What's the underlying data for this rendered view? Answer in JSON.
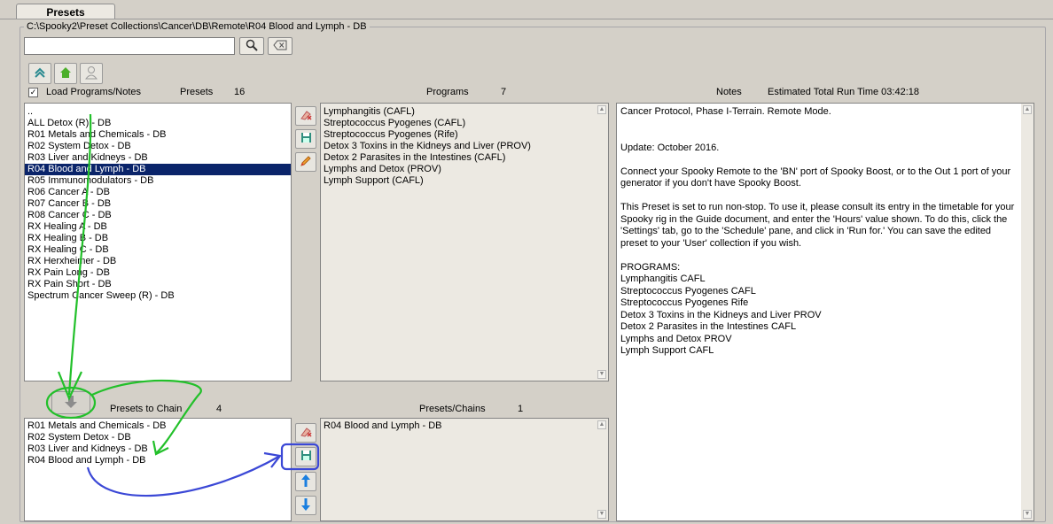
{
  "tab": {
    "label": "Presets"
  },
  "group": {
    "path": "C:\\Spooky2\\Preset Collections\\Cancer\\DB\\Remote\\R04 Blood and Lymph - DB"
  },
  "search": {
    "value": "",
    "placeholder": ""
  },
  "load_programs": {
    "label": "Load Programs/Notes",
    "checked": true
  },
  "presets": {
    "label": "Presets",
    "count": "16",
    "items": [
      "..",
      "ALL Detox (R) - DB",
      "R01 Metals and Chemicals - DB",
      "R02 System Detox - DB",
      "R03 Liver and Kidneys - DB",
      "R04 Blood and Lymph - DB",
      "R05 Immunomodulators - DB",
      "R06 Cancer A - DB",
      "R07 Cancer B - DB",
      "R08 Cancer C - DB",
      "RX Healing A - DB",
      "RX Healing B - DB",
      "RX Healing C - DB",
      "RX Herxheimer - DB",
      "RX Pain Long - DB",
      "RX Pain Short - DB",
      "Spectrum Cancer Sweep (R) - DB"
    ],
    "selected_index": 5
  },
  "programs": {
    "label": "Programs",
    "count": "7",
    "items": [
      "Lymphangitis (CAFL)",
      "Streptococcus Pyogenes (CAFL)",
      "Streptococcus Pyogenes (Rife)",
      "Detox 3 Toxins in the Kidneys and Liver (PROV)",
      "Detox 2 Parasites in the Intestines (CAFL)",
      "Lymphs and Detox (PROV)",
      "Lymph Support (CAFL)"
    ]
  },
  "notes": {
    "label": "Notes",
    "runtime": "Estimated Total Run Time 03:42:18",
    "lines": [
      "Cancer Protocol, Phase I-Terrain. Remote Mode.",
      "",
      "",
      "Update: October 2016.",
      "",
      "Connect your Spooky Remote to the 'BN' port of Spooky Boost, or to the Out 1 port of your generator if you don't have Spooky Boost.",
      "",
      "This Preset is set to run non-stop. To use it, please consult its entry in the timetable for your Spooky rig in the Guide document, and enter the 'Hours' value shown. To do this, click the 'Settings' tab, go to the 'Schedule' pane, and click in 'Run for.' You can save the edited preset to your 'User' collection if you wish.",
      "",
      "PROGRAMS:",
      "Lymphangitis CAFL",
      "Streptococcus Pyogenes CAFL",
      "Streptococcus Pyogenes Rife",
      "Detox 3 Toxins in the Kidneys and Liver PROV",
      "Detox 2 Parasites in the Intestines CAFL",
      "Lymphs and Detox PROV",
      "Lymph Support CAFL"
    ]
  },
  "chain": {
    "label": "Presets to Chain",
    "count": "4",
    "items": [
      "R01 Metals and Chemicals - DB",
      "R02 System Detox - DB",
      "R03 Liver and Kidneys - DB",
      "R04 Blood and Lymph - DB"
    ]
  },
  "preset_chains": {
    "label": "Presets/Chains",
    "count": "1",
    "items": [
      "R04 Blood and Lymph - DB"
    ]
  },
  "icons": {
    "search": "search-icon",
    "clear": "clear-icon",
    "up": "up-icon",
    "home": "home-icon",
    "user": "user-icon",
    "delete": "delete-icon",
    "save": "save-icon",
    "edit": "edit-icon",
    "add": "down-arrow-icon",
    "move_up": "arrow-up-icon",
    "move_down": "arrow-down-icon"
  },
  "colors": {
    "window_bg": "#d4d0c8",
    "selection": "#0a246a",
    "annotation_green": "#22c02a",
    "annotation_blue": "#3b48d6"
  }
}
